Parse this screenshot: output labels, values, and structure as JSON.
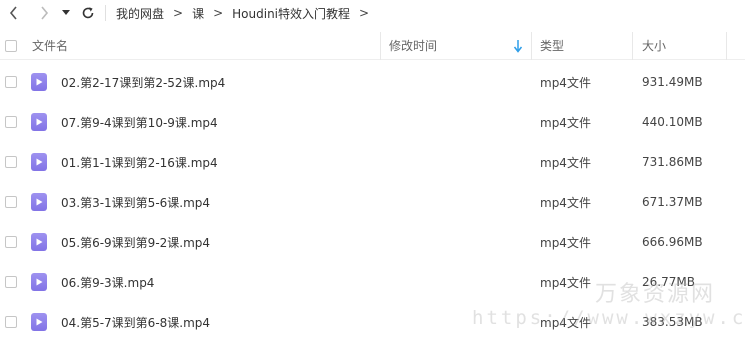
{
  "nav": {
    "back_icon": "chevron-left-icon",
    "forward_icon": "chevron-right-icon",
    "dropdown_icon": "caret-down-icon",
    "refresh_icon": "refresh-icon"
  },
  "breadcrumb": [
    "我的网盘",
    "课",
    "Houdini特效入门教程"
  ],
  "columns": {
    "name": "文件名",
    "mtime": "修改时间",
    "type": "类型",
    "size": "大小"
  },
  "sort": {
    "column": "mtime",
    "direction": "desc",
    "icon": "sort-down-arrow-icon",
    "color": "#2d9de8"
  },
  "files": [
    {
      "name": "02.第2-17课到第2-52课.mp4",
      "type": "mp4文件",
      "size": "931.49MB"
    },
    {
      "name": "07.第9-4课到第10-9课.mp4",
      "type": "mp4文件",
      "size": "440.10MB"
    },
    {
      "name": "01.第1-1课到第2-16课.mp4",
      "type": "mp4文件",
      "size": "731.86MB"
    },
    {
      "name": "03.第3-1课到第5-6课.mp4",
      "type": "mp4文件",
      "size": "671.37MB"
    },
    {
      "name": "05.第6-9课到第9-2课.mp4",
      "type": "mp4文件",
      "size": "666.96MB"
    },
    {
      "name": "06.第9-3课.mp4",
      "type": "mp4文件",
      "size": "26.77MB"
    },
    {
      "name": "04.第5-7课到第6-8课.mp4",
      "type": "mp4文件",
      "size": "383.53MB"
    }
  ],
  "file_icon": "video-file-icon",
  "watermark": {
    "text": "万象资源网",
    "url": "https://www.wxzyw.cn"
  },
  "colors": {
    "file_icon": "#8b7cea",
    "accent": "#2d9de8"
  }
}
